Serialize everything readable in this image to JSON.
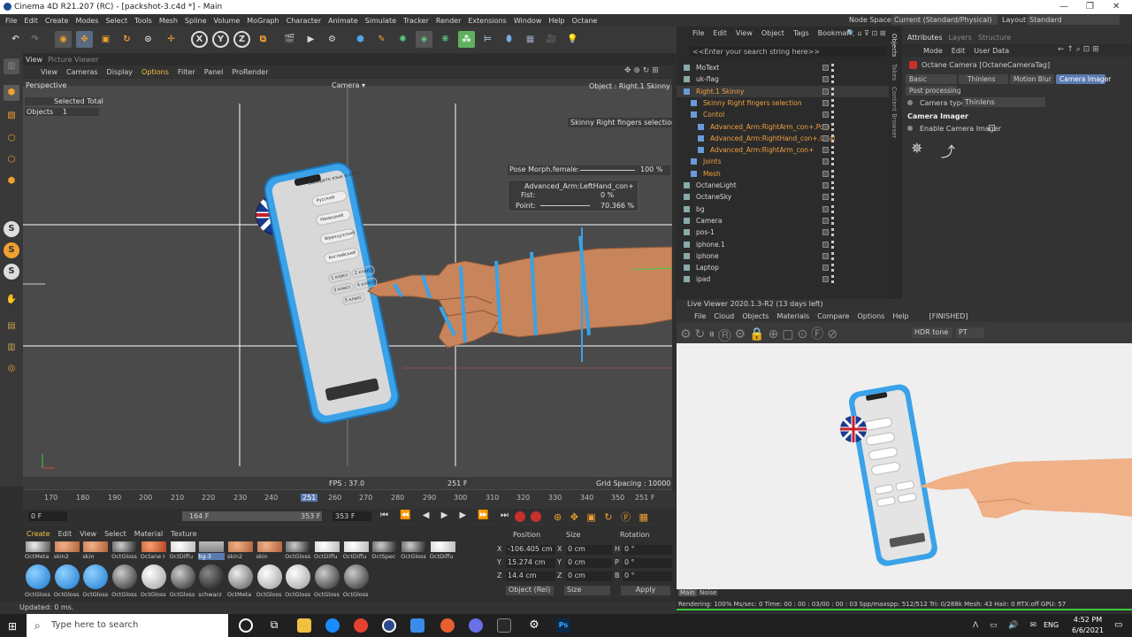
{
  "window": {
    "title": "Cinema 4D R21.207 (RC) - [packshot-3.c4d *] - Main",
    "minimize": "—",
    "maximize": "❐",
    "close": "✕"
  },
  "menu": [
    "File",
    "Edit",
    "Create",
    "Modes",
    "Select",
    "Tools",
    "Mesh",
    "Spline",
    "Volume",
    "MoGraph",
    "Character",
    "Animate",
    "Simulate",
    "Tracker",
    "Render",
    "Extensions",
    "Window",
    "Help",
    "Octane"
  ],
  "nodespace": {
    "label": "Node Space:",
    "value": "Current (Standard/Physical)"
  },
  "layout": {
    "label": "Layout:",
    "value": "Standard"
  },
  "vptabs": {
    "viewport": "View",
    "picture": "Picture Viewer"
  },
  "vpmenu": [
    "View",
    "Cameras",
    "Display",
    "Options",
    "Filter",
    "Panel",
    "ProRender"
  ],
  "viewport": {
    "perspective": "Perspective",
    "camera": "Camera ▾",
    "object_label": "Object : Right.1 Skinny",
    "selected_total": "Selected Total",
    "objects_label": "Objects",
    "objects_count": "1",
    "selection_tag": "Skinny Right fingers selection",
    "pose_morph": "Pose Morph.female:",
    "pose_value": "100 %",
    "adv_title": "Advanced_Arm:LeftHand_con+",
    "fist": "Fist:",
    "fist_value": "0 %",
    "point": "Point:",
    "point_value": "70.366 %",
    "fps": "FPS : 37.0",
    "frame": "251 F",
    "grid": "Grid Spacing : 10000 cm",
    "phone_title": "Выберите язык и класс",
    "lang1": "Русский",
    "lang2": "Немецкий",
    "lang3": "Французский",
    "lang4": "Английский",
    "class1": "1 класс",
    "class2": "2 класс",
    "class3": "3 класс",
    "class4": "4 класс",
    "class5": "5 класс"
  },
  "timeline": {
    "ticks": [
      "170",
      "180",
      "190",
      "200",
      "210",
      "220",
      "230",
      "240",
      "251",
      "260",
      "270",
      "280",
      "290",
      "300",
      "310",
      "320",
      "330",
      "340",
      "350"
    ],
    "end": "251 F",
    "current": "0 F",
    "start": "164 F",
    "range_end": "353 F",
    "max": "353 F"
  },
  "materials": {
    "menu": [
      "Create",
      "Edit",
      "View",
      "Select",
      "Material",
      "Texture"
    ],
    "row1": [
      "OctMeta",
      "skin2",
      "skin",
      "OctGloss",
      "Octane I",
      "OctDiffu",
      "bg-3",
      "skin2",
      "skin",
      "OctGloss",
      "OctDiffu",
      "OctDiffu",
      "OctSpec",
      "OctGloss",
      "OctDiffu"
    ],
    "row2": [
      "OctGloss",
      "OctGloss",
      "OctGloss",
      "OctGloss",
      "OctGloss",
      "OctGloss",
      "schwarz",
      "OctMeta",
      "OctGloss",
      "OctGloss",
      "OctGloss",
      "OctGloss"
    ]
  },
  "coords": {
    "headers": [
      "Position",
      "Size",
      "Rotation"
    ],
    "rows": [
      {
        "a": "X",
        "pos": "-106.405 cm",
        "s": "X",
        "size": "0 cm",
        "r": "H",
        "rot": "0 °"
      },
      {
        "a": "Y",
        "pos": "15.274 cm",
        "s": "Y",
        "size": "0 cm",
        "r": "P",
        "rot": "0 °"
      },
      {
        "a": "Z",
        "pos": "14.4 cm",
        "s": "Z",
        "size": "0 cm",
        "r": "B",
        "rot": "0 °"
      }
    ],
    "mode": "Object (Rel)",
    "size_mode": "Size",
    "apply": "Apply"
  },
  "status": "Updated: 0 ms.",
  "objects": {
    "menu": [
      "File",
      "Edit",
      "View",
      "Object",
      "Tags",
      "Bookmark"
    ],
    "search": "<<Enter your search string here>>",
    "items": [
      {
        "name": "MoText",
        "indent": 0,
        "color": "#d8d8d8"
      },
      {
        "name": "uk-flag",
        "indent": 0,
        "color": "#d8d8d8"
      },
      {
        "name": "Right.1 Skinny",
        "indent": 0,
        "color": "#f0a040"
      },
      {
        "name": "Skinny Right fingers selection",
        "indent": 1,
        "color": "#f0a040"
      },
      {
        "name": "Contol",
        "indent": 1,
        "color": "#f0a040"
      },
      {
        "name": "Advanced_Arm:RightArm_con+.Pole",
        "indent": 2,
        "color": "#f0a040"
      },
      {
        "name": "Advanced_Arm:RightHand_con+.Goal",
        "indent": 2,
        "color": "#f0a040"
      },
      {
        "name": "Advanced_Arm:RightArm_con+",
        "indent": 2,
        "color": "#f0a040"
      },
      {
        "name": "Joints",
        "indent": 1,
        "color": "#f0a040"
      },
      {
        "name": "Mesh",
        "indent": 1,
        "color": "#f0a040"
      },
      {
        "name": "OctaneLight",
        "indent": 0,
        "color": "#d8d8d8"
      },
      {
        "name": "OctaneSky",
        "indent": 0,
        "color": "#d8d8d8"
      },
      {
        "name": "bg",
        "indent": 0,
        "color": "#d8d8d8"
      },
      {
        "name": "Camera",
        "indent": 0,
        "color": "#d8d8d8"
      },
      {
        "name": "pos-1",
        "indent": 0,
        "color": "#d8d8d8"
      },
      {
        "name": "iphone.1",
        "indent": 0,
        "color": "#d8d8d8"
      },
      {
        "name": "iphone",
        "indent": 0,
        "color": "#d8d8d8"
      },
      {
        "name": "Laptop",
        "indent": 0,
        "color": "#d8d8d8"
      },
      {
        "name": "ipad",
        "indent": 0,
        "color": "#d8d8d8"
      }
    ]
  },
  "sidetabs": [
    "Objects",
    "Takes",
    "Content Browser"
  ],
  "attributes": {
    "tabs": [
      "Attributes",
      "Layers",
      "Structure"
    ],
    "menu": [
      "Mode",
      "Edit",
      "User Data"
    ],
    "tag": "Octane Camera [OctaneCameraTag]",
    "subtabs": [
      "Basic",
      "Thinlens",
      "Motion Blur",
      "Camera Imager"
    ],
    "post": "Post processing",
    "camera_type_label": "Camera type",
    "camera_type": "Thinlens",
    "section": "Camera Imager",
    "enable": "Enable Camera Imager"
  },
  "liveviewer": {
    "title": "Live Viewer 2020.1.3-R2 (13 days left)",
    "menu": [
      "File",
      "Cloud",
      "Objects",
      "Materials",
      "Compare",
      "Options",
      "Help"
    ],
    "state": "[FINISHED]",
    "tone": "HDR tone",
    "pt": "PT",
    "tabs": [
      "Main",
      "Noise"
    ],
    "stats": "Rendering: 100%  Ms/sec: 0   Time: 00 : 00 : 03/00 : 00 : 03  Spp/maxspp: 512/512   Tri: 0/288k  Mesh: 43   Hair: 0   RTX:off    GPU:  57"
  },
  "taskbar": {
    "search": "Type here to search",
    "lang": "ENG",
    "time": "4:52 PM",
    "date": "6/6/2021"
  }
}
